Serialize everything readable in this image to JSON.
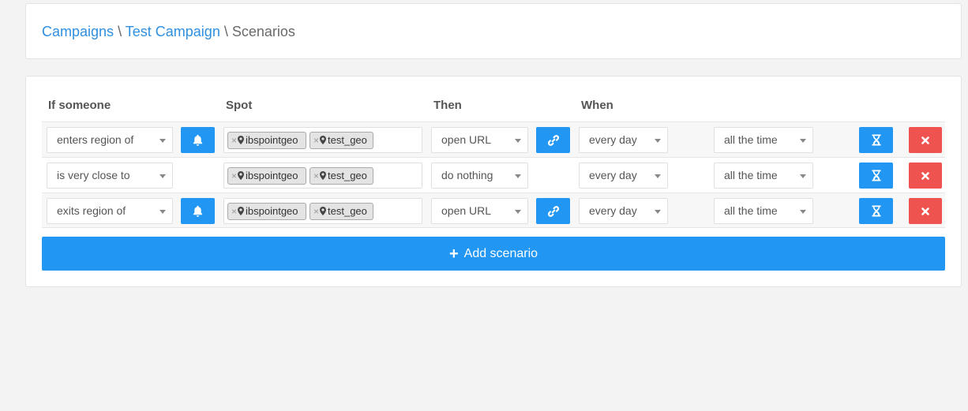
{
  "breadcrumb": {
    "campaigns": "Campaigns",
    "sep1": "\\",
    "campaign": "Test Campaign",
    "sep2": "\\",
    "current": "Scenarios"
  },
  "table": {
    "headers": {
      "if_someone": "If someone",
      "spot": "Spot",
      "then": "Then",
      "when": "When"
    },
    "rows": [
      {
        "trigger": "enters region of",
        "has_notify": true,
        "spots": [
          "ibspointgeo",
          "test_geo"
        ],
        "action": "open URL",
        "has_link": true,
        "day": "every day",
        "time": "all the time"
      },
      {
        "trigger": "is very close to",
        "has_notify": false,
        "spots": [
          "ibspointgeo",
          "test_geo"
        ],
        "action": "do nothing",
        "has_link": false,
        "day": "every day",
        "time": "all the time"
      },
      {
        "trigger": "exits region of",
        "has_notify": true,
        "spots": [
          "ibspointgeo",
          "test_geo"
        ],
        "action": "open URL",
        "has_link": true,
        "day": "every day",
        "time": "all the time"
      }
    ],
    "tag_remove_glyph": "×"
  },
  "add_button": {
    "label": "Add scenario",
    "icon": "+"
  },
  "icons": {
    "notify": "bell-icon",
    "link": "link-icon",
    "schedule": "hourglass-icon",
    "delete": "times-icon",
    "spot": "map-marker-icon"
  },
  "colors": {
    "primary": "#2196f3",
    "danger": "#ef5350",
    "link": "#2f8fe0"
  }
}
